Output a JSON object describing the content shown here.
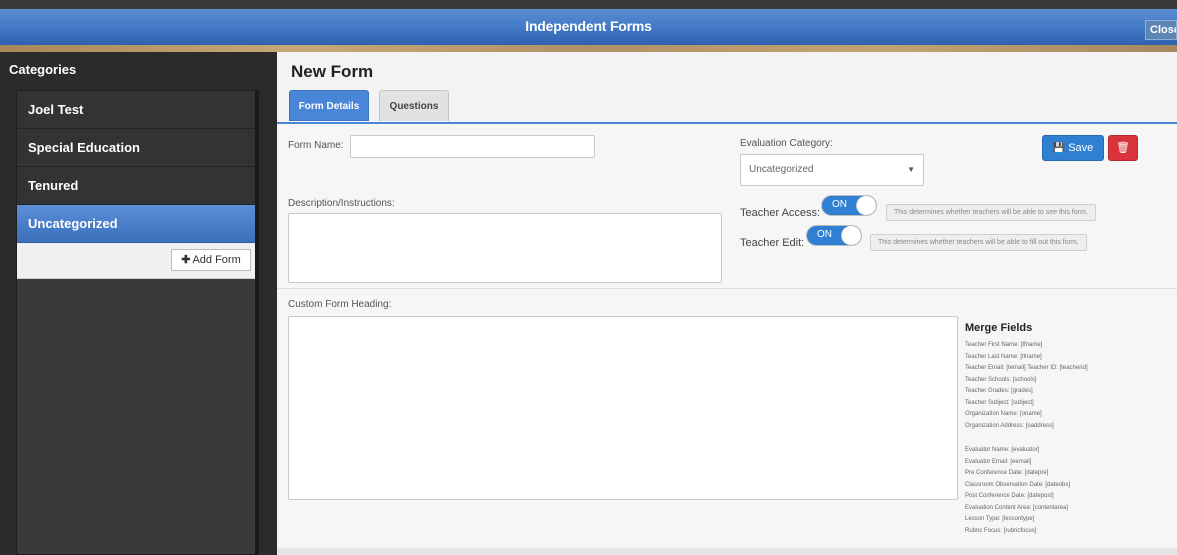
{
  "window": {
    "title": "Independent Forms",
    "close_label": "Close"
  },
  "sidebar": {
    "title": "Categories",
    "items": [
      {
        "label": "Joel Test"
      },
      {
        "label": "Special Education"
      },
      {
        "label": "Tenured"
      },
      {
        "label": "Uncategorized"
      }
    ],
    "add_form_label": "Add Form"
  },
  "main": {
    "heading": "New Form",
    "tabs": [
      {
        "label": "Form Details"
      },
      {
        "label": "Questions"
      }
    ],
    "form_name_label": "Form Name:",
    "form_name_value": "",
    "evaluation_category_label": "Evaluation Category:",
    "evaluation_category_value": "Uncategorized",
    "save_label": "Save",
    "description_label": "Description/Instructions:",
    "teacher_access_label": "Teacher Access:",
    "teacher_access_state": "ON",
    "teacher_access_hint": "This determines whether teachers will be able to see this form.",
    "teacher_edit_label": "Teacher Edit:",
    "teacher_edit_state": "ON",
    "teacher_edit_hint": "This determines whether teachers will be able to fill out this form.",
    "custom_heading_label": "Custom Form Heading:",
    "merge_fields_title": "Merge Fields",
    "merge_fields_group1": [
      "Teacher First Name: [tfname]",
      "Teacher Last Name: [tlname]",
      "Teacher Email: [temail] Teacher ID: [teacherid]",
      "Teacher Schools: [schools]",
      "Teacher Grades: [grades]",
      "Teacher Subject: [subject]",
      "Organization Name: [oname]",
      "Organization Address: [oaddress]"
    ],
    "merge_fields_group2": [
      "Evaluator Name: [evaluator]",
      "Evaluator Email: [eemail]",
      "Pre Conference Date: [datepre]",
      "Classroom Observation Date: [dateobs]",
      "Post Conference Date: [datepost]",
      "Evaluation Content Area: [contentarea]",
      "Lesson Type: [lessontype]",
      "Rubric Focus: [rubricfocus]"
    ]
  },
  "colors": {
    "accent": "#4a86d8",
    "save": "#2f7fd3",
    "delete": "#d9343b"
  }
}
